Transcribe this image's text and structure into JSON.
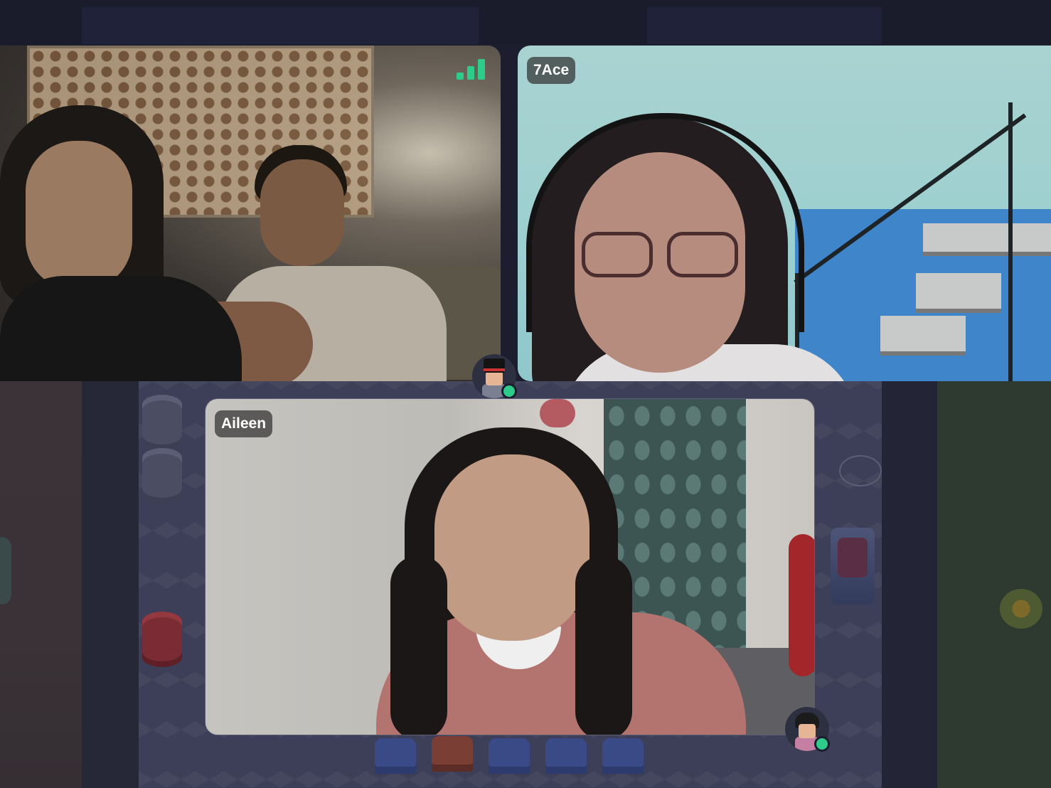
{
  "participants": {
    "host": {
      "label": ""
    },
    "ace": {
      "label": "7Ace"
    },
    "aileen": {
      "label": "Aileen"
    }
  },
  "icons": {
    "signal": "signal-strength-icon",
    "host_avatar": "avatar-top-hat",
    "aileen_avatar": "avatar-glasses"
  },
  "status": {
    "host_online": true,
    "aileen_online": true
  },
  "colors": {
    "status_online": "#2ecc8a",
    "signal_bars": "#2ecc8a",
    "label_bg": "#3a3a3a",
    "label_text": "#ffffff",
    "page_bg": "#1c1d2e"
  }
}
